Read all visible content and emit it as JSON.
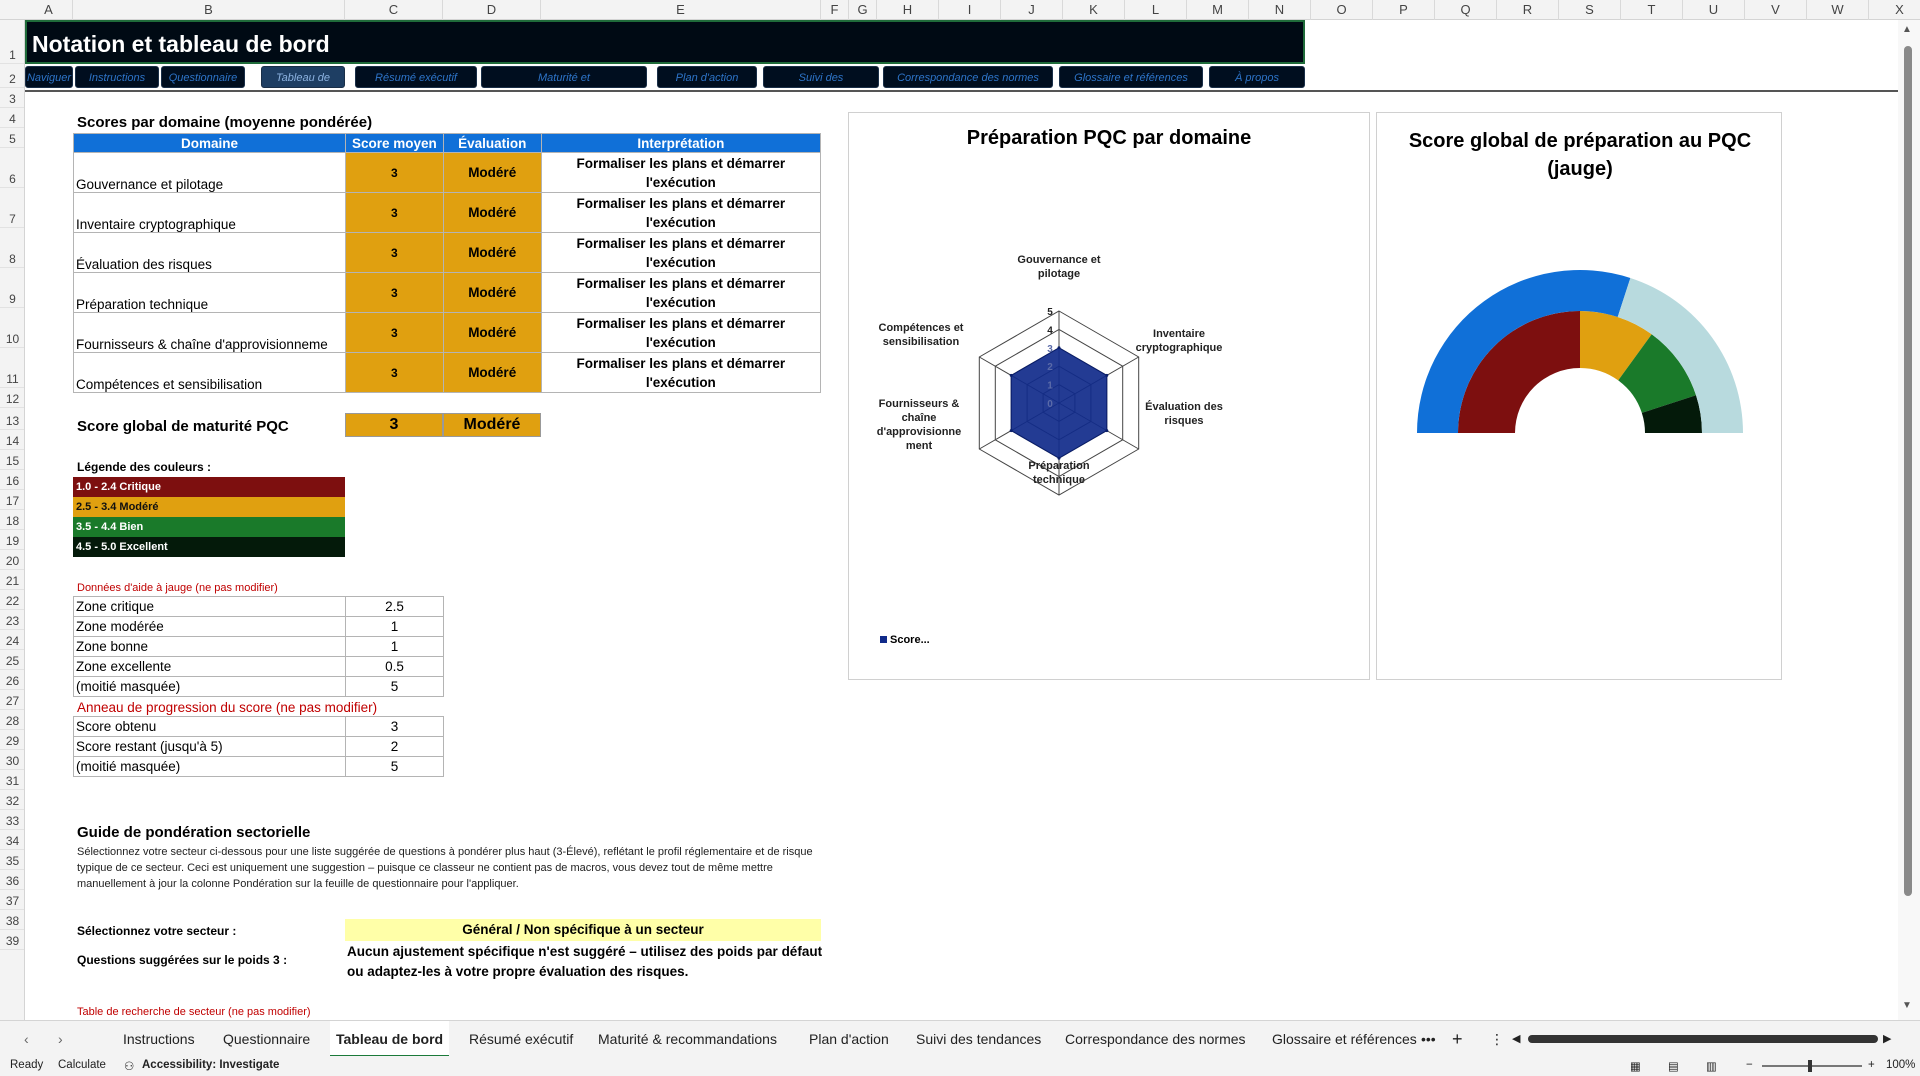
{
  "columns": [
    "A",
    "B",
    "C",
    "D",
    "E",
    "F",
    "G",
    "H",
    "I",
    "J",
    "K",
    "L",
    "M",
    "N",
    "O",
    "P",
    "Q",
    "R",
    "S",
    "T",
    "U",
    "V",
    "W",
    "X"
  ],
  "rows": [
    "1",
    "2",
    "3",
    "4",
    "5",
    "6",
    "7",
    "8",
    "9",
    "10",
    "11",
    "12",
    "13",
    "14",
    "15",
    "16",
    "17",
    "18",
    "19",
    "20",
    "21",
    "22",
    "23",
    "24",
    "25",
    "26",
    "27",
    "28",
    "29",
    "30",
    "31",
    "32",
    "33",
    "34",
    "35",
    "36",
    "37",
    "38",
    "39"
  ],
  "title": "Notation et tableau de bord",
  "nav_buttons": [
    "Naviguer",
    "Instructions",
    "Questionnaire",
    "Tableau de",
    "Résumé exécutif",
    "Maturité et",
    "Plan d'action",
    "Suivi des",
    "Correspondance des normes",
    "Glossaire et références",
    "À propos"
  ],
  "domain_section": {
    "title": "Scores par domaine (moyenne pondérée)",
    "headers": [
      "Domaine",
      "Score moyen",
      "Évaluation",
      "Interprétation"
    ],
    "rows": [
      {
        "name": "Gouvernance et pilotage",
        "score": "3",
        "eval": "Modéré",
        "interp": "Formaliser les plans et démarrer l'exécution"
      },
      {
        "name": "Inventaire cryptographique",
        "score": "3",
        "eval": "Modéré",
        "interp": "Formaliser les plans et démarrer l'exécution"
      },
      {
        "name": "Évaluation des risques",
        "score": "3",
        "eval": "Modéré",
        "interp": "Formaliser les plans et démarrer l'exécution"
      },
      {
        "name": "Préparation technique",
        "score": "3",
        "eval": "Modéré",
        "interp": "Formaliser les plans et démarrer l'exécution"
      },
      {
        "name": "Fournisseurs & chaîne d'approvisionneme",
        "score": "3",
        "eval": "Modéré",
        "interp": "Formaliser les plans et démarrer l'exécution"
      },
      {
        "name": "Compétences et sensibilisation",
        "score": "3",
        "eval": "Modéré",
        "interp": "Formaliser les plans et démarrer l'exécution"
      }
    ]
  },
  "global": {
    "label": "Score global de maturité PQC",
    "score": "3",
    "eval": "Modéré"
  },
  "legend": {
    "title": "Légende des couleurs :",
    "items": [
      {
        "label": "1.0 - 2.4 Critique",
        "color": "#7d0f0f"
      },
      {
        "label": "2.5 - 3.4 Modéré",
        "color": "#e0a010"
      },
      {
        "label": "3.5 - 4.4 Bien",
        "color": "#1a7a2a"
      },
      {
        "label": "4.5 - 5.0 Excellent",
        "color": "#041a0a"
      }
    ]
  },
  "gauge_helper": {
    "note": "Données d'aide à jauge (ne pas modifier)",
    "rows": [
      {
        "label": "Zone critique",
        "value": "2.5"
      },
      {
        "label": "Zone modérée",
        "value": "1"
      },
      {
        "label": "Zone bonne",
        "value": "1"
      },
      {
        "label": "Zone excellente",
        "value": "0.5"
      },
      {
        "label": "(moitié masquée)",
        "value": "5"
      }
    ]
  },
  "ring_helper": {
    "note": "Anneau de progression du score (ne pas modifier)",
    "rows": [
      {
        "label": "Score obtenu",
        "value": "3"
      },
      {
        "label": "Score restant (jusqu'à 5)",
        "value": "2"
      },
      {
        "label": "(moitié masquée)",
        "value": "5"
      }
    ]
  },
  "guide": {
    "title": "Guide de pondération sectorielle",
    "text": "Sélectionnez votre secteur ci-dessous pour une liste suggérée de questions à pondérer plus haut (3-Élevé), reflétant le profil réglementaire et de risque typique de ce secteur. Ceci est uniquement une suggestion – puisque ce classeur ne contient pas de macros, vous devez tout de même mettre manuellement à jour la colonne Pondération sur la feuille de questionnaire pour l'appliquer.",
    "sector_label": "Sélectionnez votre secteur :",
    "sector_value": "Général / Non spécifique à un secteur",
    "suggest_label": "Questions suggérées sur le poids 3 :",
    "suggest_value": "Aucun ajustement spécifique n'est suggéré – utilisez des poids par défaut ou adaptez-les à votre propre évaluation des risques.",
    "lookup_note": "Table de recherche de secteur (ne pas modifier)"
  },
  "chart_data": [
    {
      "type": "radar",
      "title": "Préparation PQC par domaine",
      "categories": [
        "Gouvernance et pilotage",
        "Inventaire cryptographique",
        "Évaluation des risques",
        "Préparation technique",
        "Fournisseurs & chaîne d'approvisionnement",
        "Compétences et sensibilisation"
      ],
      "category_labels": [
        [
          "Gouvernance et",
          "pilotage"
        ],
        [
          "Inventaire",
          "cryptographique"
        ],
        [
          "Évaluation des",
          "risques"
        ],
        [
          "Préparation",
          "technique"
        ],
        [
          "Fournisseurs &",
          "chaîne",
          "d'approvisionne",
          "ment"
        ],
        [
          "Compétences et",
          "sensibilisation"
        ]
      ],
      "series": [
        {
          "name": "Score...",
          "values": [
            3,
            3,
            3,
            3,
            3,
            3
          ],
          "color": "#102a8a"
        }
      ],
      "rlim": [
        0,
        5
      ],
      "ticks": [
        "0",
        "1",
        "2",
        "3",
        "4",
        "5"
      ],
      "legend": "bottom-left"
    },
    {
      "type": "gauge",
      "title": "Score global de préparation au PQC (jauge)",
      "zones": [
        {
          "name": "Zone critique",
          "value": 2.5,
          "color": "#7d0f0f"
        },
        {
          "name": "Zone modérée",
          "value": 1,
          "color": "#e0a010"
        },
        {
          "name": "Zone bonne",
          "value": 1,
          "color": "#1a7a2a"
        },
        {
          "name": "Zone excellente",
          "value": 0.5,
          "color": "#041a0a"
        }
      ],
      "progress": {
        "obtained": 3,
        "remaining": 2,
        "obtained_color": "#1070d8",
        "remaining_color": "#b8dade"
      },
      "max": 5
    }
  ],
  "sheet_tabs": [
    "Instructions",
    "Questionnaire",
    "Tableau de bord",
    "Résumé exécutif",
    "Maturité & recommandations",
    "Plan d'action",
    "Suivi des tendances",
    "Correspondance des normes",
    "Glossaire et références"
  ],
  "active_tab": "Tableau de bord",
  "status": {
    "ready": "Ready",
    "calculate": "Calculate",
    "accessibility": "Accessibility: Investigate",
    "zoom": "100%"
  }
}
